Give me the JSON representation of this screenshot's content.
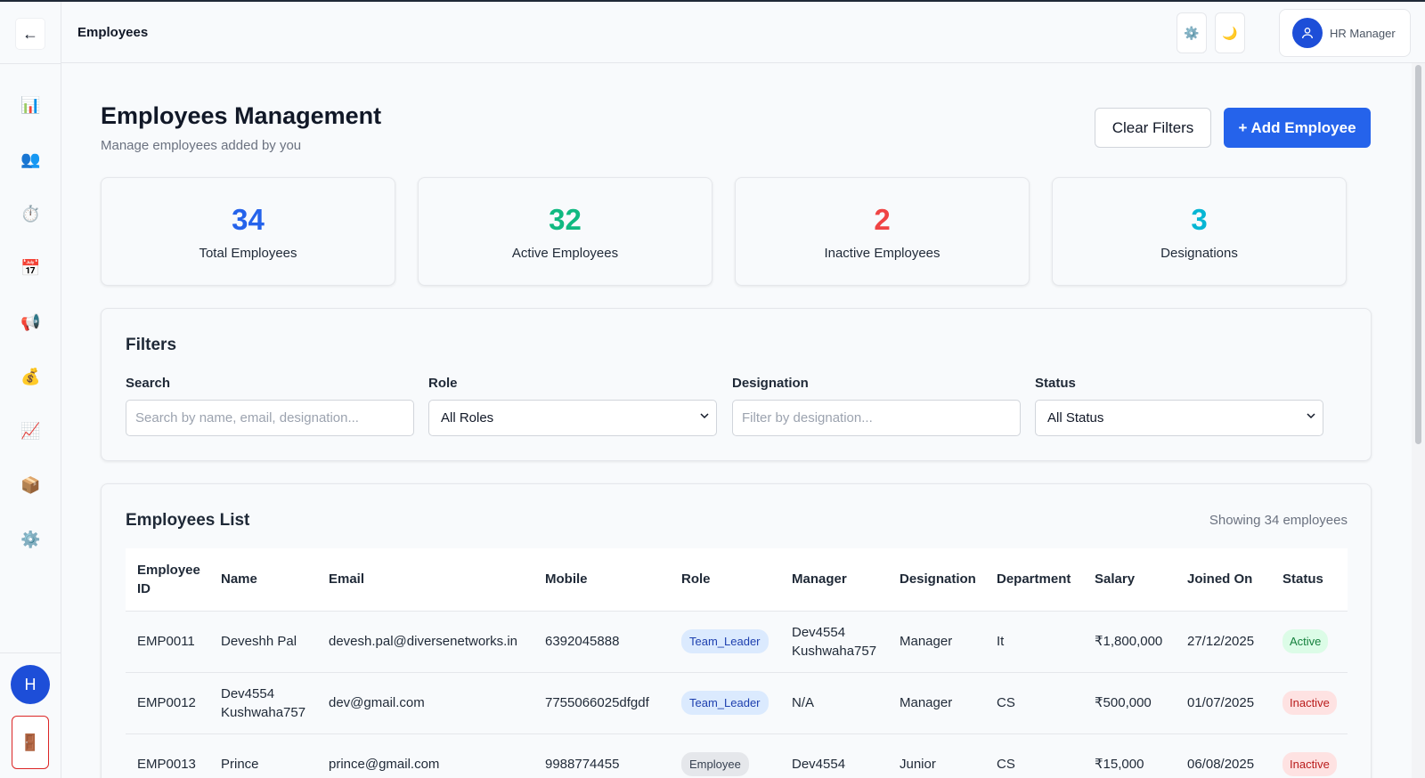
{
  "header": {
    "title": "Employees",
    "settings_icon": "⚙️",
    "theme_icon": "🌙",
    "user_label": "HR Manager"
  },
  "sidebar": {
    "back_icon": "←",
    "items": [
      {
        "name": "dashboard",
        "icon": "📊"
      },
      {
        "name": "employees",
        "icon": "👥"
      },
      {
        "name": "attendance",
        "icon": "⏱️"
      },
      {
        "name": "calendar",
        "icon": "📅"
      },
      {
        "name": "announcements",
        "icon": "📢"
      },
      {
        "name": "payroll",
        "icon": "💰"
      },
      {
        "name": "reports",
        "icon": "📈"
      },
      {
        "name": "assets",
        "icon": "📦"
      },
      {
        "name": "settings",
        "icon": "⚙️"
      }
    ],
    "avatar_letter": "H",
    "logout_icon": "🚪"
  },
  "page": {
    "title": "Employees Management",
    "subtitle": "Manage employees added by you",
    "clear_filters": "Clear Filters",
    "add_employee": "+ Add Employee"
  },
  "stats": [
    {
      "value": "34",
      "label": "Total Employees",
      "color": "#2563eb"
    },
    {
      "value": "32",
      "label": "Active Employees",
      "color": "#10b981"
    },
    {
      "value": "2",
      "label": "Inactive Employees",
      "color": "#ef4444"
    },
    {
      "value": "3",
      "label": "Designations",
      "color": "#06b6d4"
    }
  ],
  "filters": {
    "title": "Filters",
    "search_label": "Search",
    "search_placeholder": "Search by name, email, designation...",
    "role_label": "Role",
    "role_value": "All Roles",
    "designation_label": "Designation",
    "designation_placeholder": "Filter by designation...",
    "status_label": "Status",
    "status_value": "All Status"
  },
  "list": {
    "title": "Employees List",
    "count": "Showing 34 employees",
    "columns": [
      "Employee ID",
      "Name",
      "Email",
      "Mobile",
      "Role",
      "Manager",
      "Designation",
      "Department",
      "Salary",
      "Joined On",
      "Status"
    ],
    "rows": [
      {
        "id": "EMP0011",
        "name": "Deveshh Pal",
        "email": "devesh.pal@diversenetworks.in",
        "mobile": "6392045888",
        "role": "Team_Leader",
        "manager": "Dev4554 Kushwaha757",
        "designation": "Manager",
        "department": "It",
        "salary": "₹1,800,000",
        "joined": "27/12/2025",
        "status": "Active"
      },
      {
        "id": "EMP0012",
        "name": "Dev4554 Kushwaha757",
        "email": "dev@gmail.com",
        "mobile": "7755066025dfgdf",
        "role": "Team_Leader",
        "manager": "N/A",
        "designation": "Manager",
        "department": "CS",
        "salary": "₹500,000",
        "joined": "01/07/2025",
        "status": "Inactive"
      },
      {
        "id": "EMP0013",
        "name": "Prince",
        "email": "prince@gmail.com",
        "mobile": "9988774455",
        "role": "Employee",
        "manager": "Dev4554",
        "designation": "Junior",
        "department": "CS",
        "salary": "₹15,000",
        "joined": "06/08/2025",
        "status": "Inactive"
      }
    ]
  }
}
